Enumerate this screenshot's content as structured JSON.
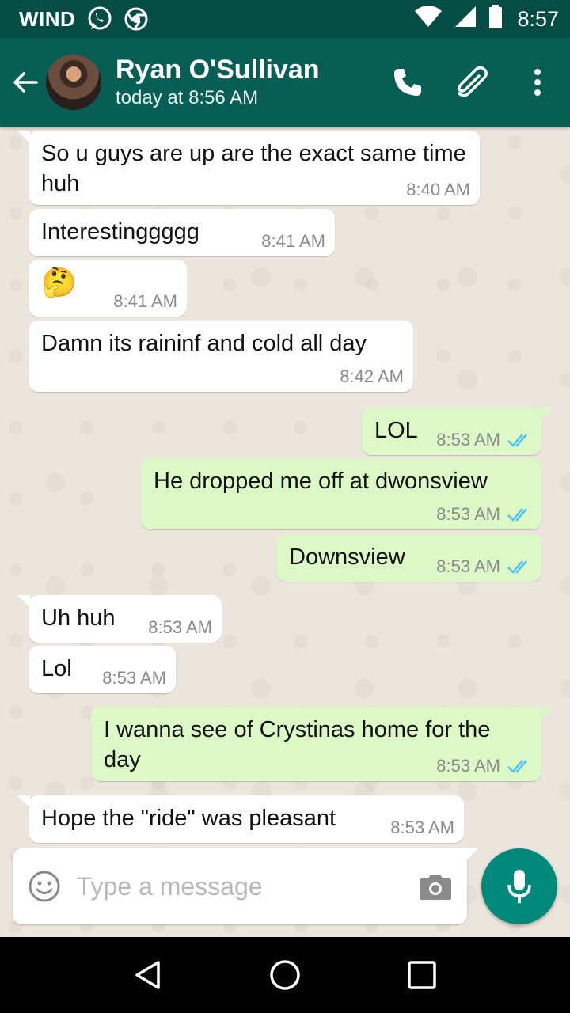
{
  "status_bar": {
    "carrier": "WIND",
    "time": "8:57",
    "icons": [
      "whatsapp-icon",
      "chrome-icon",
      "wifi-icon",
      "signal-icon",
      "battery-icon"
    ]
  },
  "header": {
    "contact_name": "Ryan O'Sullivan",
    "last_seen": "today at 8:56 AM",
    "icons": [
      "back-arrow-icon",
      "phone-icon",
      "paperclip-icon",
      "more-vert-icon"
    ]
  },
  "messages": [
    {
      "direction": "in",
      "text": "So u guys are up are the exact same time huh",
      "time": "8:40 AM"
    },
    {
      "direction": "in",
      "text": "Interestinggggg",
      "time": "8:41 AM"
    },
    {
      "direction": "in",
      "text": "🤔",
      "time": "8:41 AM"
    },
    {
      "direction": "in",
      "text": "Damn its raininf and cold all day",
      "time": "8:42 AM"
    },
    {
      "direction": "out",
      "text": "LOL",
      "time": "8:53 AM",
      "status": "read"
    },
    {
      "direction": "out",
      "text": "He dropped me off at dwonsview",
      "time": "8:53 AM",
      "status": "read"
    },
    {
      "direction": "out",
      "text": "Downsview",
      "time": "8:53 AM",
      "status": "read"
    },
    {
      "direction": "in",
      "text": "Uh huh",
      "time": "8:53 AM"
    },
    {
      "direction": "in",
      "text": "Lol",
      "time": "8:53 AM"
    },
    {
      "direction": "out",
      "text": "I wanna see of Crystinas home for the day",
      "time": "8:53 AM",
      "status": "read"
    },
    {
      "direction": "in",
      "text": "Hope the \"ride\" was pleasant",
      "time": "8:53 AM"
    }
  ],
  "composer": {
    "placeholder": "Type a message",
    "value": ""
  },
  "colors": {
    "status_bar": "#054d44",
    "app_bar": "#075e54",
    "chat_bg": "#ece5dd",
    "outgoing_bubble": "#dcf8c6",
    "incoming_bubble": "#ffffff",
    "read_ticks": "#4fc3f7",
    "fab": "#00897b"
  }
}
